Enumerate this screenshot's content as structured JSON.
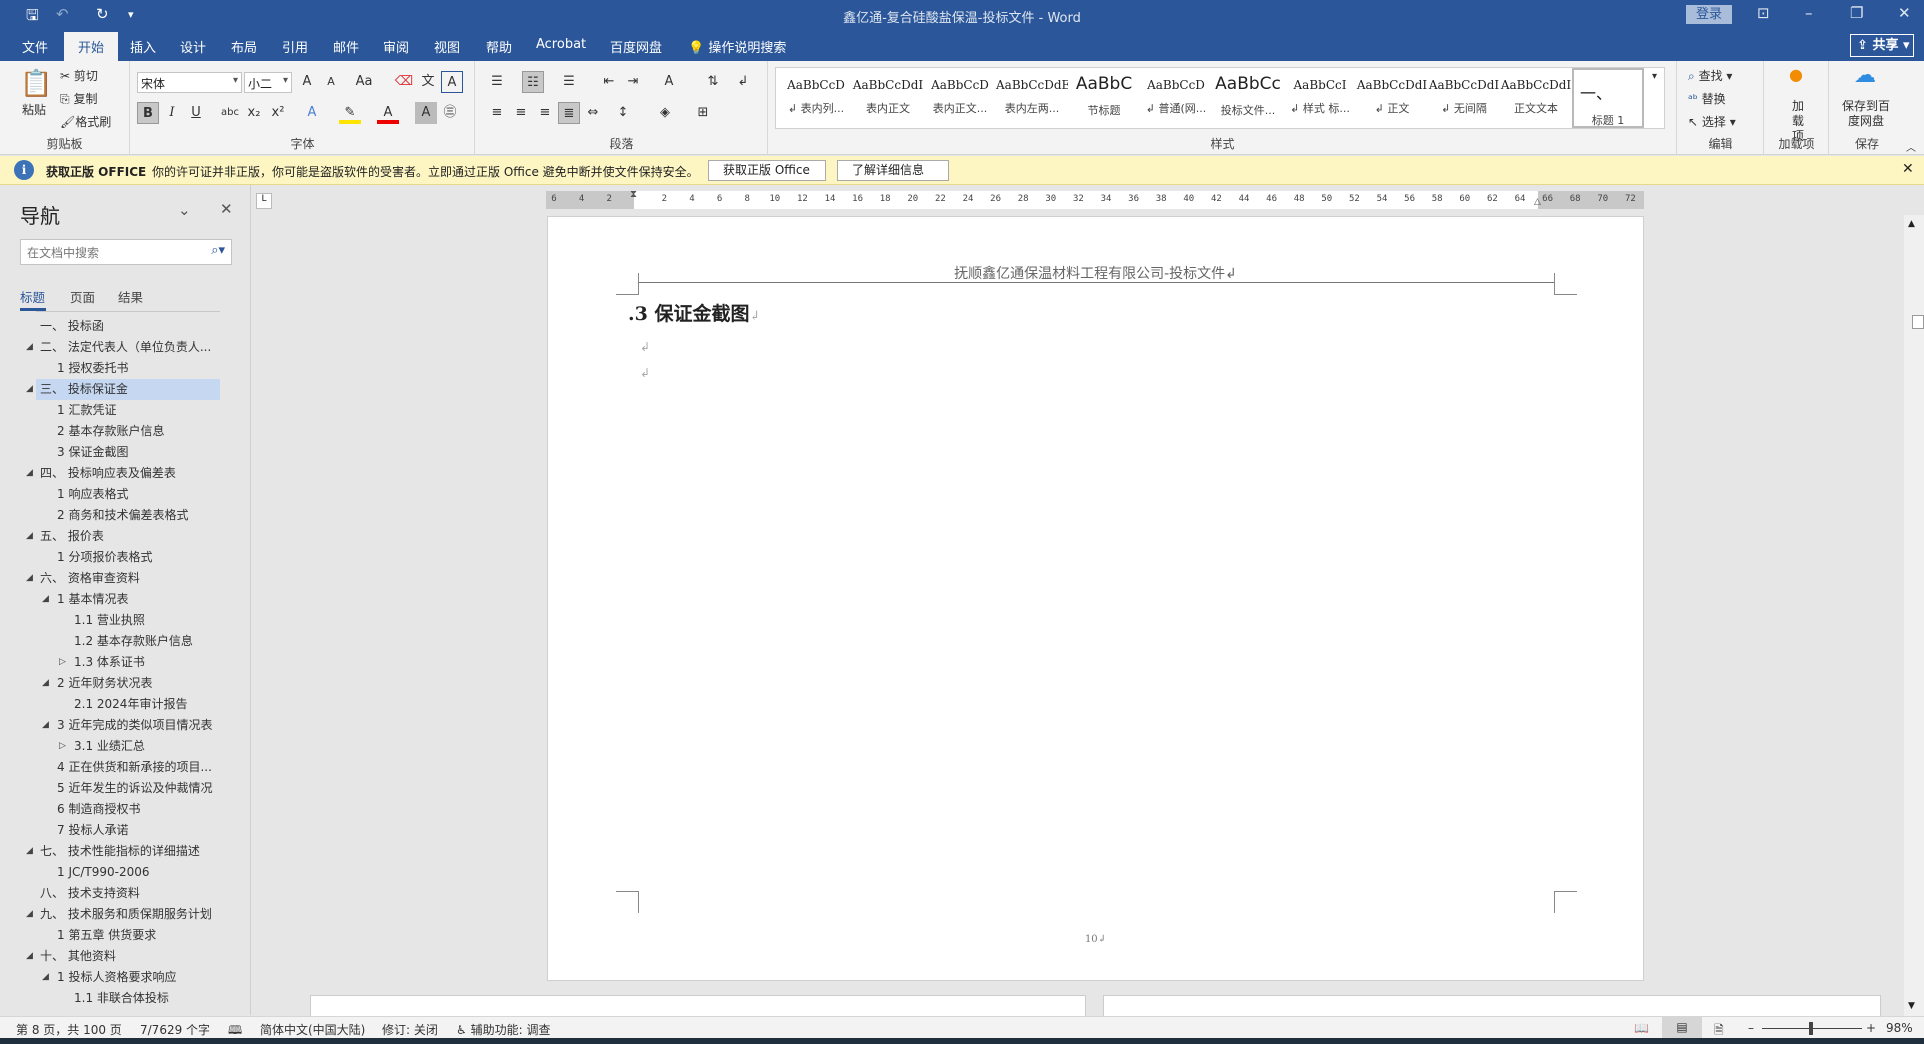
{
  "titlebar": {
    "title": "鑫亿通-复合硅酸盐保温-投标文件  -  Word",
    "login": "登录",
    "icons": [
      "save-icon",
      "undo-icon",
      "redo-icon",
      "customize-qat-icon"
    ]
  },
  "tabs": [
    "文件",
    "开始",
    "插入",
    "设计",
    "布局",
    "引用",
    "邮件",
    "审阅",
    "视图",
    "帮助",
    "Acrobat",
    "百度网盘"
  ],
  "active_tab": "开始",
  "tell_me": "操作说明搜索",
  "share": "共享",
  "ribbon": {
    "clipboard": {
      "label": "剪贴板",
      "paste": "粘贴",
      "cut": "剪切",
      "copy": "复制",
      "format_painter": "格式刷"
    },
    "font": {
      "label": "字体",
      "font_name": "宋体",
      "font_size": "小二",
      "grow": "A",
      "shrink": "A",
      "case": "Aa",
      "bold": "B",
      "italic": "I",
      "underline": "U",
      "strike": "abc",
      "sub": "x₂",
      "sup": "x²"
    },
    "paragraph": {
      "label": "段落"
    },
    "styles": {
      "label": "样式",
      "items": [
        {
          "preview": "AaBbCcD",
          "name": "↲ 表内列..."
        },
        {
          "preview": "AaBbCcDdI",
          "name": "表内正文"
        },
        {
          "preview": "AaBbCcD",
          "name": "表内正文..."
        },
        {
          "preview": "AaBbCcDdEe",
          "name": "表内左两..."
        },
        {
          "preview": "AaBbC",
          "name": "节标题"
        },
        {
          "preview": "AaBbCcD",
          "name": "↲ 普通(网..."
        },
        {
          "preview": "AaBbCc",
          "name": "投标文件..."
        },
        {
          "preview": "AaBbCcI",
          "name": "↲ 样式 标..."
        },
        {
          "preview": "AaBbCcDdI",
          "name": "↲ 正文"
        },
        {
          "preview": "AaBbCcDdI",
          "name": "↲ 无间隔"
        },
        {
          "preview": "AaBbCcDdI",
          "name": "正文文本"
        },
        {
          "preview": "一、",
          "name": "标题 1"
        }
      ],
      "selected": "标题 1"
    },
    "editing": {
      "label": "编辑",
      "find": "查找",
      "replace": "替换",
      "select": "选择"
    },
    "addins": {
      "label": "加载项",
      "button": "加载项"
    },
    "save": {
      "label": "保存",
      "button": "保存到百度网盘"
    }
  },
  "infobar": {
    "title": "获取正版 OFFICE",
    "message": "你的许可证并非正版，你可能是盗版软件的受害者。立即通过正版 Office 避免中断并使文件保持安全。",
    "btn_get": "获取正版 Office",
    "btn_learn": "了解详细信息"
  },
  "nav": {
    "title": "导航",
    "search_placeholder": "在文档中搜索",
    "tabs": [
      "标题",
      "页面",
      "结果"
    ],
    "active_tab": "标题",
    "items": [
      {
        "text": "一、  投标函",
        "level": 1,
        "toggle": "none"
      },
      {
        "text": "二、  法定代表人（单位负责人...",
        "level": 1,
        "toggle": "expanded"
      },
      {
        "text": "1 授权委托书",
        "level": 2,
        "toggle": "none"
      },
      {
        "text": "三、  投标保证金",
        "level": 1,
        "toggle": "expanded",
        "selected": true
      },
      {
        "text": "1 汇款凭证",
        "level": 2,
        "toggle": "none"
      },
      {
        "text": "2 基本存款账户信息",
        "level": 2,
        "toggle": "none"
      },
      {
        "text": "3 保证金截图",
        "level": 2,
        "toggle": "none"
      },
      {
        "text": "四、  投标响应表及偏差表",
        "level": 1,
        "toggle": "expanded"
      },
      {
        "text": "1 响应表格式",
        "level": 2,
        "toggle": "none"
      },
      {
        "text": "2 商务和技术偏差表格式",
        "level": 2,
        "toggle": "none"
      },
      {
        "text": "五、  报价表",
        "level": 1,
        "toggle": "expanded"
      },
      {
        "text": "1 分项报价表格式",
        "level": 2,
        "toggle": "none"
      },
      {
        "text": "六、  资格审查资料",
        "level": 1,
        "toggle": "expanded"
      },
      {
        "text": "1 基本情况表",
        "level": 2,
        "toggle": "expanded"
      },
      {
        "text": "1.1 营业执照",
        "level": 3,
        "toggle": "none"
      },
      {
        "text": "1.2 基本存款账户信息",
        "level": 3,
        "toggle": "none"
      },
      {
        "text": "1.3 体系证书",
        "level": 3,
        "toggle": "collapsed"
      },
      {
        "text": "2 近年财务状况表",
        "level": 2,
        "toggle": "expanded"
      },
      {
        "text": "2.1 2024年审计报告",
        "level": 3,
        "toggle": "none"
      },
      {
        "text": "3 近年完成的类似项目情况表",
        "level": 2,
        "toggle": "expanded"
      },
      {
        "text": "3.1 业绩汇总",
        "level": 3,
        "toggle": "collapsed"
      },
      {
        "text": "4 正在供货和新承接的项目...",
        "level": 2,
        "toggle": "none"
      },
      {
        "text": "5 近年发生的诉讼及仲裁情况",
        "level": 2,
        "toggle": "none"
      },
      {
        "text": "6 制造商授权书",
        "level": 2,
        "toggle": "none"
      },
      {
        "text": "7 投标人承诺",
        "level": 2,
        "toggle": "none"
      },
      {
        "text": "七、  技术性能指标的详细描述",
        "level": 1,
        "toggle": "expanded"
      },
      {
        "text": "1 JC/T990-2006",
        "level": 2,
        "toggle": "none"
      },
      {
        "text": "八、  技术支持资料",
        "level": 1,
        "toggle": "none"
      },
      {
        "text": "九、  技术服务和质保期服务计划",
        "level": 1,
        "toggle": "expanded"
      },
      {
        "text": "1 第五章  供货要求",
        "level": 2,
        "toggle": "none"
      },
      {
        "text": "十、  其他资料",
        "level": 1,
        "toggle": "expanded"
      },
      {
        "text": "1 投标人资格要求响应",
        "level": 2,
        "toggle": "expanded"
      },
      {
        "text": "1.1 非联合体投标",
        "level": 3,
        "toggle": "none"
      }
    ]
  },
  "ruler": {
    "ticks": [
      "6",
      "4",
      "2",
      "",
      "2",
      "4",
      "6",
      "8",
      "10",
      "12",
      "14",
      "16",
      "18",
      "20",
      "22",
      "24",
      "26",
      "28",
      "30",
      "32",
      "34",
      "36",
      "38",
      "40",
      "42",
      "44",
      "46",
      "48",
      "50",
      "52",
      "54",
      "56",
      "58",
      "60",
      "62",
      "64",
      "66",
      "68",
      "70",
      "72"
    ]
  },
  "document": {
    "header": "抚顺鑫亿通保温材料工程有限公司-投标文件↲",
    "heading": ".3  保证金截图",
    "heading_mark": "↲",
    "para_mark": "↲",
    "footer": "10↲"
  },
  "statusbar": {
    "page": "第 8 页，共 100 页",
    "words": "7/7629 个字",
    "language": "简体中文(中国大陆)",
    "track": "修订: 关闭",
    "accessibility": "辅助功能: 调查",
    "zoom": "98%",
    "zoom_value": 98
  }
}
